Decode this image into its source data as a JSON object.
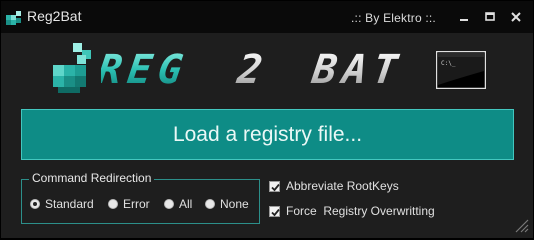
{
  "window": {
    "title": "Reg2Bat",
    "byline": ".:: By Elektro ::.",
    "icons": [
      "app-icon",
      "minimize-icon",
      "maximize-icon",
      "close-icon"
    ]
  },
  "logo": {
    "text": "REG 2 BAT",
    "icons": [
      "registry-cubes-icon",
      "terminal-window-icon"
    ]
  },
  "actions": {
    "load_label": "Load a registry file..."
  },
  "redirection": {
    "legend": "Command Redirection",
    "options": [
      {
        "label": "Standard",
        "selected": true
      },
      {
        "label": "Error",
        "selected": false
      },
      {
        "label": "All",
        "selected": false
      },
      {
        "label": "None",
        "selected": false
      }
    ]
  },
  "options": {
    "abbreviate_label": "Abbreviate RootKeys",
    "abbreviate_checked": true,
    "force_label": "Force  Registry Overwritting",
    "force_checked": true
  },
  "colors": {
    "accent": "#0e8c86",
    "accent_border": "#43c7bf",
    "background": "#1e1e1e",
    "titlebar": "#0a0a0a"
  }
}
